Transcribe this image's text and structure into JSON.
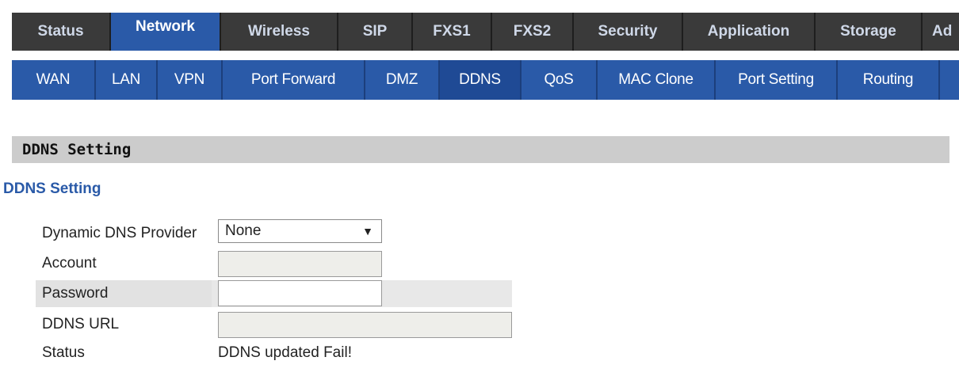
{
  "top_tabs": [
    {
      "label": "Status"
    },
    {
      "label": "Network"
    },
    {
      "label": "Wireless"
    },
    {
      "label": "SIP"
    },
    {
      "label": "FXS1"
    },
    {
      "label": "FXS2"
    },
    {
      "label": "Security"
    },
    {
      "label": "Application"
    },
    {
      "label": "Storage"
    },
    {
      "label": "Ad"
    }
  ],
  "active_top_tab": "Network",
  "sub_tabs": [
    {
      "label": "WAN"
    },
    {
      "label": "LAN"
    },
    {
      "label": "VPN"
    },
    {
      "label": "Port Forward"
    },
    {
      "label": "DMZ"
    },
    {
      "label": "DDNS"
    },
    {
      "label": "QoS"
    },
    {
      "label": "MAC Clone"
    },
    {
      "label": "Port Setting"
    },
    {
      "label": "Routing"
    }
  ],
  "active_sub_tab": "DDNS",
  "section": {
    "header": "DDNS Setting",
    "title": "DDNS Setting"
  },
  "form": {
    "provider_label": "Dynamic DNS Provider",
    "provider_value": "None",
    "account_label": "Account",
    "account_value": "",
    "password_label": "Password",
    "password_value": "",
    "url_label": "DDNS URL",
    "url_value": "",
    "status_label": "Status",
    "status_value": "DDNS updated Fail!"
  },
  "colors": {
    "accent_blue": "#2a5aa8",
    "top_bar_dark": "#3a3a3a",
    "section_gray": "#cccccc"
  }
}
